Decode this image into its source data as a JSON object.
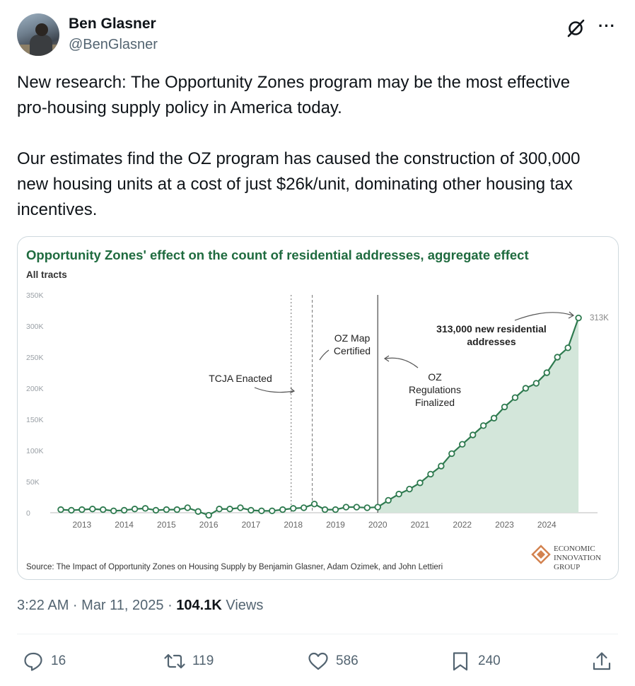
{
  "author": {
    "name": "Ben Glasner",
    "handle": "@BenGlasner"
  },
  "icons": {
    "grok": "grok-icon",
    "more": "more-icon",
    "reply": "reply-icon",
    "retweet": "retweet-icon",
    "like": "like-icon",
    "bookmark": "bookmark-icon",
    "share": "share-icon"
  },
  "more_label": "···",
  "tweet": {
    "paragraph1": "New research: The Opportunity Zones program may be the most effective  pro-housing supply policy in America today.",
    "paragraph2": "Our estimates find the OZ program has caused the construction of 300,000 new housing units at a cost of just $26k/unit,  dominating other housing tax incentives."
  },
  "chart_data": {
    "type": "area",
    "title": "Opportunity Zones' effect on the count of residential addresses, aggregate effect",
    "subtitle": "All tracts",
    "y_ticks": [
      "0",
      "50K",
      "100K",
      "150K",
      "200K",
      "250K",
      "300K",
      "350K"
    ],
    "ylim": [
      0,
      350000
    ],
    "x_ticks": [
      "2013",
      "2014",
      "2015",
      "2016",
      "2017",
      "2018",
      "2019",
      "2020",
      "2021",
      "2022",
      "2023",
      "2024"
    ],
    "xlim": [
      2012.4,
      2025.2
    ],
    "grid": false,
    "x": [
      2012.5,
      2012.75,
      2013.0,
      2013.25,
      2013.5,
      2013.75,
      2014.0,
      2014.25,
      2014.5,
      2014.75,
      2015.0,
      2015.25,
      2015.5,
      2015.75,
      2016.0,
      2016.25,
      2016.5,
      2016.75,
      2017.0,
      2017.25,
      2017.5,
      2017.75,
      2018.0,
      2018.25,
      2018.5,
      2018.75,
      2019.0,
      2019.25,
      2019.5,
      2019.75,
      2020.0,
      2020.25,
      2020.5,
      2020.75,
      2021.0,
      2021.25,
      2021.5,
      2021.75,
      2022.0,
      2022.25,
      2022.5,
      2022.75,
      2023.0,
      2023.25,
      2023.5,
      2023.75,
      2024.0,
      2024.25,
      2024.5,
      2024.75
    ],
    "y": [
      5000,
      4000,
      5000,
      6000,
      5000,
      3000,
      4000,
      6000,
      7000,
      4000,
      5000,
      5000,
      8000,
      2000,
      -4000,
      6000,
      6000,
      8000,
      4000,
      3000,
      3000,
      5000,
      7000,
      8000,
      14000,
      5000,
      5000,
      9000,
      9000,
      8000,
      9000,
      20000,
      30000,
      38000,
      48000,
      62000,
      75000,
      95000,
      110000,
      125000,
      140000,
      152000,
      170000,
      185000,
      200000,
      208000,
      225000,
      250000,
      265000,
      313000
    ],
    "vlines": [
      {
        "x": 2017.95,
        "style": "dotted"
      },
      {
        "x": 2018.45,
        "style": "dashed"
      },
      {
        "x": 2020.0,
        "style": "solid"
      }
    ],
    "annotations": {
      "tcja": "TCJA Enacted",
      "ozmap": [
        "OZ Map",
        "Certified"
      ],
      "ozreg": [
        "OZ",
        "Regulations",
        "Finalized"
      ],
      "total": [
        "313,000 new residential",
        "addresses"
      ],
      "endlabel": "313K"
    },
    "source": "Source: The Impact of Opportunity Zones on Housing Supply by Benjamin Glasner, Adam Ozimek, and John Lettieri",
    "logo_text": [
      "ECONOMIC",
      "INNOVATION",
      "GROUP"
    ],
    "colors": {
      "line": "#2e7a4f",
      "fill": "#d3e6da",
      "title": "#1f6b3f",
      "axis": "#9aa0a6"
    }
  },
  "meta": {
    "time": "3:22 AM · Mar 11, 2025 · ",
    "views_count": "104.1K",
    "views_label": " Views"
  },
  "actions": {
    "replies": "16",
    "retweets": "119",
    "likes": "586",
    "bookmarks": "240"
  }
}
